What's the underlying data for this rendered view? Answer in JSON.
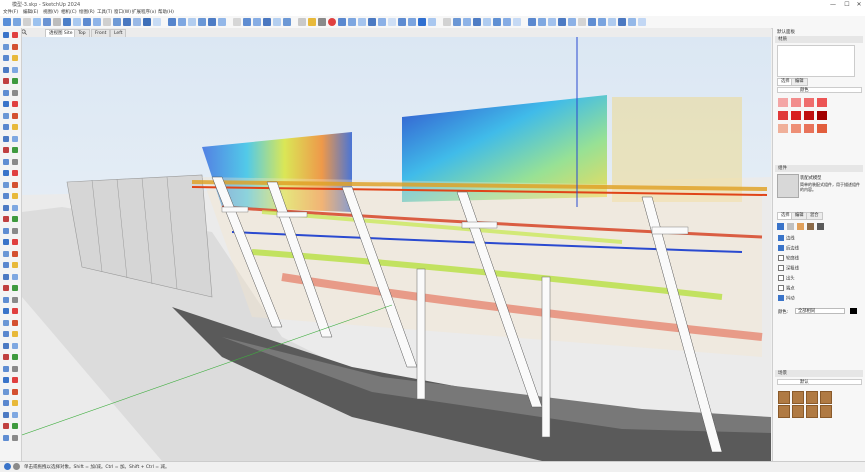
{
  "window": {
    "title": "模型-3.skp - SketchUp 2024",
    "minimize": "—",
    "maximize": "☐",
    "close": "✕"
  },
  "menu": [
    "文件(F)",
    "编辑(E)",
    "视图(V)",
    "相机(C)",
    "绘图(R)",
    "工具(T)",
    "窗口(W)",
    "扩展程序(x)",
    "帮助(H)"
  ],
  "tabs": [
    "透视图 Site",
    "Top",
    "Front",
    "Left"
  ],
  "status": {
    "text": "单击或拖拽以选择对象。Shift = 加/减。Ctrl = 加。Shift + Ctrl = 减。"
  },
  "tray": {
    "title": "默认面板",
    "material_panel": "材质",
    "material_tabs": [
      "选择",
      "编辑"
    ],
    "material_library": "颜色",
    "swatch_colors": [
      "#f4a6a6",
      "#f28c8c",
      "#ef6e6e",
      "#ec5454",
      "#e03a3a",
      "#d81f1f",
      "#c01010",
      "#a20000",
      "#f0b09a",
      "#ee8f76",
      "#e8735a",
      "#e25e3d"
    ],
    "component_panel": "组件",
    "component_name": "装配式模型",
    "component_desc": "简单的装配式组件，用于描述组件的内容。",
    "style_tabs": [
      "选择",
      "编辑",
      "混合"
    ],
    "edge_settings": [
      "边线",
      "后边线",
      "轮廓线",
      "深粗线",
      "出头",
      "端点",
      "抖动"
    ],
    "edge_checked": [
      true,
      true,
      false,
      false,
      false,
      false,
      true
    ],
    "color_label": "颜色:",
    "color_value": "全部相同",
    "lower_panel": "场景",
    "lower_select": "默认"
  }
}
